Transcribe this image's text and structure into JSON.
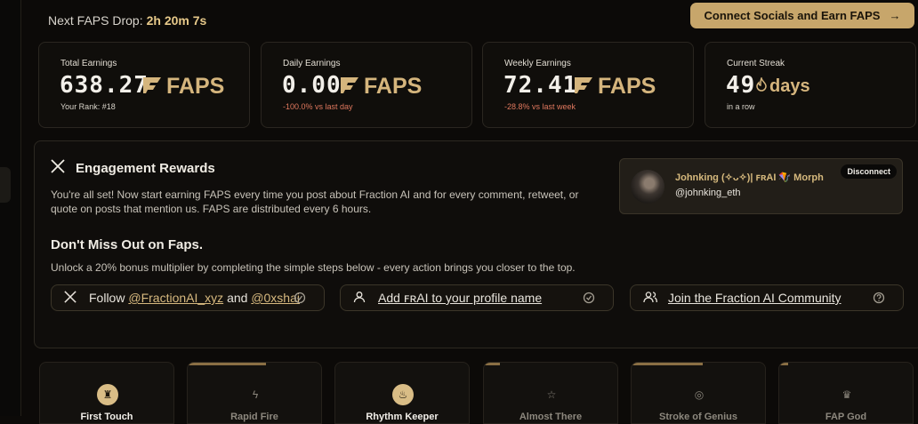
{
  "header": {
    "drop_label": "Next FAPS Drop:",
    "drop_time": "2h 20m 7s",
    "connect_label": "Connect Socials and Earn FAPS"
  },
  "stats": [
    {
      "label": "Total Earnings",
      "value": "638.27",
      "unit": "FAPS",
      "sub": "Your Rank: #18"
    },
    {
      "label": "Daily Earnings",
      "value": "0.00",
      "unit": "FAPS",
      "sub": "-100.0% vs last day"
    },
    {
      "label": "Weekly Earnings",
      "value": "72.41",
      "unit": "FAPS",
      "sub": "-28.8% vs last week"
    },
    {
      "label": "Current Streak",
      "value": "49",
      "unit": "days",
      "sub": "in a row"
    }
  ],
  "engagement": {
    "title": "Engagement Rewards",
    "description": "You're all set! Now start earning FAPS every time you post about Fraction AI and for every comment, retweet, or quote on posts that mention us. FAPS are distributed every 6 hours.",
    "dont_miss": "Don't Miss Out on Faps.",
    "unlock": "Unlock a 20% bonus multiplier by completing the simple steps below - every action brings you closer to the top.",
    "tasks": {
      "follow_prefix": "Follow",
      "follow_link1": "@FractionAI_xyz",
      "follow_and": "and",
      "follow_link2": "@0xshai",
      "profile": "Add ꜰʀAI to your profile name",
      "community": "Join the Fraction AI Community"
    },
    "profile_card": {
      "name": "Johnking (✧ᴗ✧)| ꜰʀAI 🪁 Morph",
      "handle": "@johnking_eth",
      "disconnect": "Disconnect"
    }
  },
  "badges": [
    "First Touch",
    "Rapid Fire",
    "Rhythm Keeper",
    "Almost There",
    "Stroke of Genius",
    "FAP God"
  ],
  "colors": {
    "accent": "#c7a66b",
    "negative": "#e0785e"
  }
}
